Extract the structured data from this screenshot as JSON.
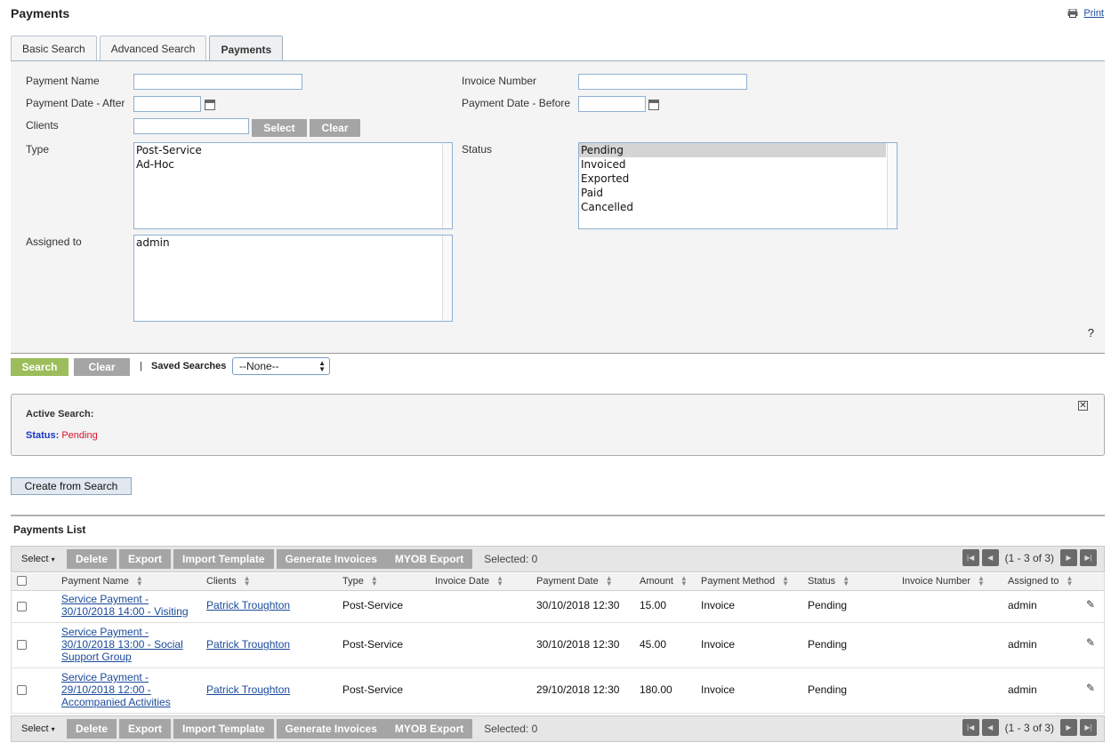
{
  "page": {
    "title": "Payments",
    "print_label": "Print"
  },
  "tabs": [
    {
      "label": "Basic Search"
    },
    {
      "label": "Advanced Search"
    },
    {
      "label": "Payments"
    }
  ],
  "form": {
    "payment_name_label": "Payment Name",
    "invoice_number_label": "Invoice Number",
    "date_after_label": "Payment Date - After",
    "date_before_label": "Payment Date - Before",
    "clients_label": "Clients",
    "select_label": "Select",
    "clear_label": "Clear",
    "type_label": "Type",
    "type_options": [
      "Post-Service",
      "Ad-Hoc"
    ],
    "status_label": "Status",
    "status_options": [
      "Pending",
      "Invoiced",
      "Exported",
      "Paid",
      "Cancelled"
    ],
    "status_selected": "Pending",
    "assigned_label": "Assigned to",
    "assigned_options": [
      "admin"
    ],
    "help": "?"
  },
  "actions": {
    "search_label": "Search",
    "clear_label": "Clear",
    "separator": "|",
    "saved_searches_label": "Saved Searches",
    "saved_searches_value": "--None--"
  },
  "active_search": {
    "title": "Active Search:",
    "key": "Status:",
    "value": "Pending",
    "close": "✕"
  },
  "create_button": "Create from Search",
  "list": {
    "title": "Payments List",
    "toolbar": {
      "select_label": "Select",
      "delete": "Delete",
      "export": "Export",
      "import_template": "Import Template",
      "generate_invoices": "Generate Invoices",
      "myob_export": "MYOB Export",
      "selected": "Selected: 0",
      "pagination": "(1 - 3 of 3)"
    },
    "columns": {
      "name": "Payment Name",
      "clients": "Clients",
      "type": "Type",
      "invoice_date": "Invoice Date",
      "payment_date": "Payment Date",
      "amount": "Amount",
      "method": "Payment Method",
      "status": "Status",
      "invoice_number": "Invoice Number",
      "assigned": "Assigned to"
    },
    "rows": [
      {
        "name": [
          "Service Payment -",
          "30/10/2018 14:00 - Visiting"
        ],
        "clients": "Patrick Troughton",
        "type": "Post-Service",
        "invoice_date": "",
        "payment_date": "30/10/2018 12:30",
        "amount": "15.00",
        "method": "Invoice",
        "status": "Pending",
        "invoice_number": "",
        "assigned": "admin"
      },
      {
        "name": [
          "Service Payment -",
          "30/10/2018 13:00 - Social",
          "Support Group"
        ],
        "clients": "Patrick Troughton",
        "type": "Post-Service",
        "invoice_date": "",
        "payment_date": "30/10/2018 12:30",
        "amount": "45.00",
        "method": "Invoice",
        "status": "Pending",
        "invoice_number": "",
        "assigned": "admin"
      },
      {
        "name": [
          "Service Payment -",
          "29/10/2018 12:00 -",
          "Accompanied Activities"
        ],
        "clients": "Patrick Troughton",
        "type": "Post-Service",
        "invoice_date": "",
        "payment_date": "29/10/2018 12:30",
        "amount": "180.00",
        "method": "Invoice",
        "status": "Pending",
        "invoice_number": "",
        "assigned": "admin"
      }
    ]
  }
}
